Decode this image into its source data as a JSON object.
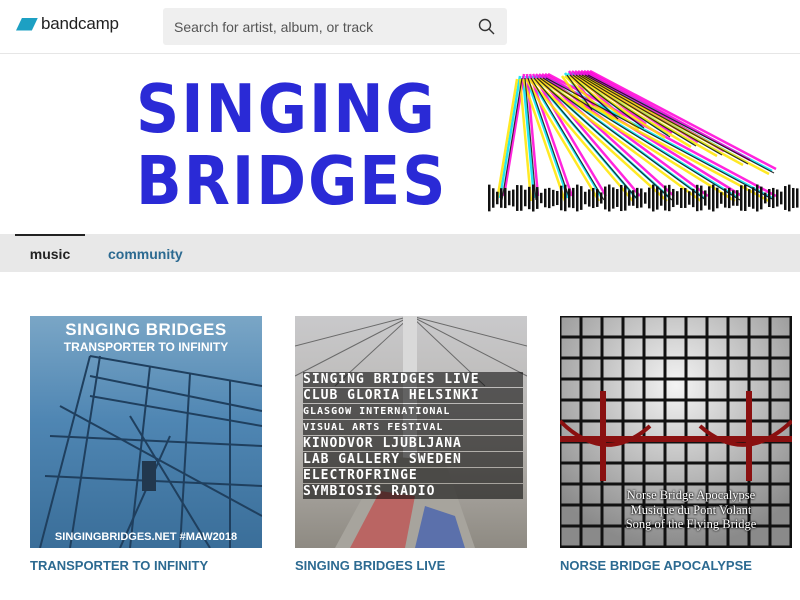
{
  "header": {
    "logo_text": "bandcamp",
    "search": {
      "placeholder": "Search for artist, album, or track"
    },
    "icons": {
      "logo": "bandcamp-logo-icon",
      "search": "search-icon"
    }
  },
  "banner": {
    "title_line1": "SINGING",
    "title_line2": "BRIDGES",
    "colors": {
      "title": "#2a2ad6",
      "art": [
        "#00e0f0",
        "#ff00d8",
        "#ffe600",
        "#111111"
      ]
    }
  },
  "tabs": [
    {
      "label": "music",
      "active": true
    },
    {
      "label": "community",
      "active": false
    }
  ],
  "albums": [
    {
      "title": "TRANSPORTER TO INFINITY",
      "cover_text": [
        "SINGING BRIDGES",
        "TRANSPORTER TO INFINITY",
        "SINGINGBRIDGES.NET #MAW2018"
      ]
    },
    {
      "title": "SINGING BRIDGES LIVE",
      "cover_text": [
        "SINGING BRIDGES LIVE",
        "CLUB GLORIA HELSINKI",
        "GLASGOW INTERNATIONAL",
        "VISUAL ARTS FESTIVAL",
        "KINODVOR LJUBLJANA",
        "LAB GALLERY SWEDEN",
        "ELECTROFRINGE",
        "SYMBIOSIS RADIO"
      ]
    },
    {
      "title": "NORSE BRIDGE APOCALYPSE",
      "cover_text": [
        "Norse Bridge Apocalypse",
        "Musique du Pont Volant",
        "Song of the Flying Bridge"
      ]
    }
  ],
  "colors": {
    "link": "#2c6a91",
    "logo_accent": "#1da0c3",
    "tab_bar": "#e8e8e8"
  }
}
